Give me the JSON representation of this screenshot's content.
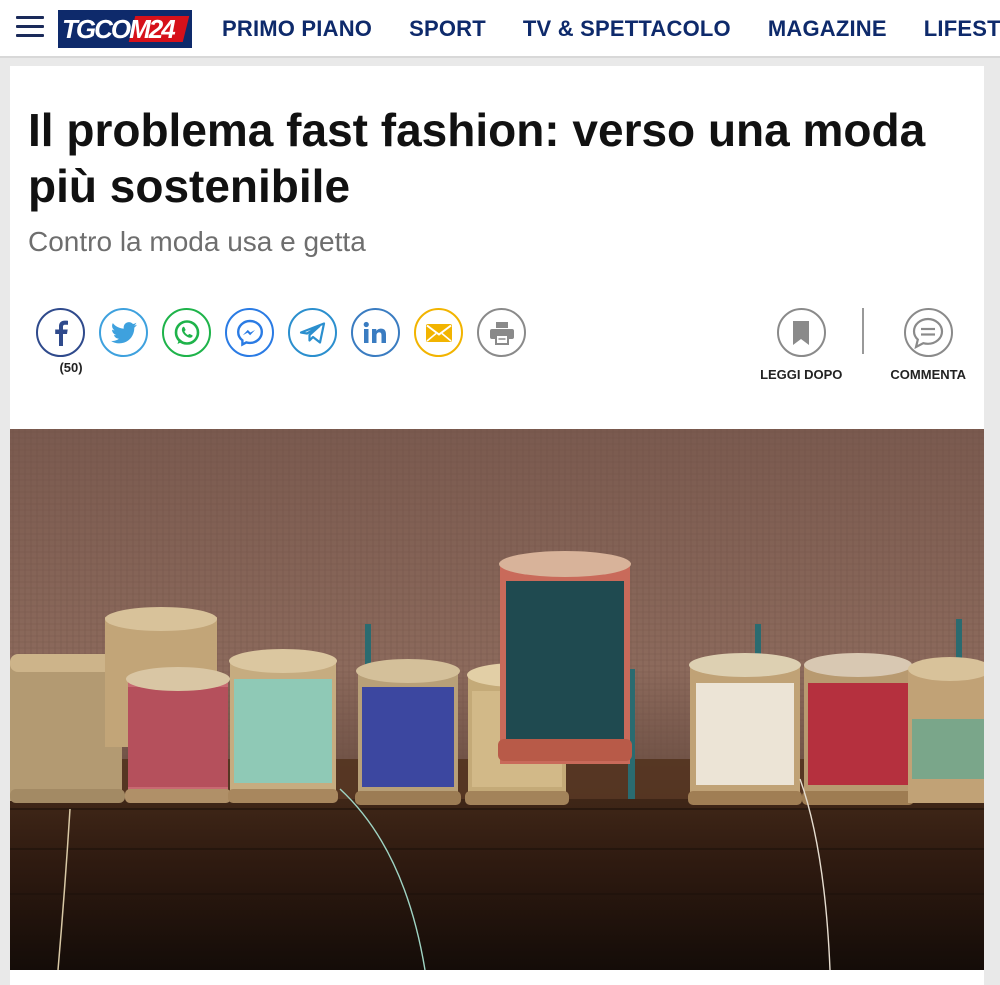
{
  "header": {
    "logo_text": "TGCOM24",
    "nav": [
      "PRIMO PIANO",
      "SPORT",
      "TV & SPETTACOLO",
      "MAGAZINE",
      "LIFESTYLE"
    ]
  },
  "article": {
    "title": "Il problema fast fashion: verso una moda più sostenibile",
    "subtitle": "Contro la moda usa e getta",
    "share": {
      "facebook_count": "(50)",
      "icons": [
        "facebook-icon",
        "twitter-icon",
        "whatsapp-icon",
        "messenger-icon",
        "telegram-icon",
        "linkedin-icon",
        "email-icon",
        "print-icon"
      ]
    },
    "actions": {
      "read_later": "LEGGI DOPO",
      "comment": "COMMENTA"
    }
  },
  "colors": {
    "brand_navy": "#0e2a6b",
    "brand_red": "#d6111a",
    "facebook": "#2f4a8c",
    "twitter": "#3ea1de",
    "whatsapp": "#1eb34a",
    "messenger": "#2a7be4",
    "telegram": "#2b8fce",
    "linkedin": "#3a7cc1",
    "email": "#f2b400",
    "print": "#8a8a8a"
  }
}
